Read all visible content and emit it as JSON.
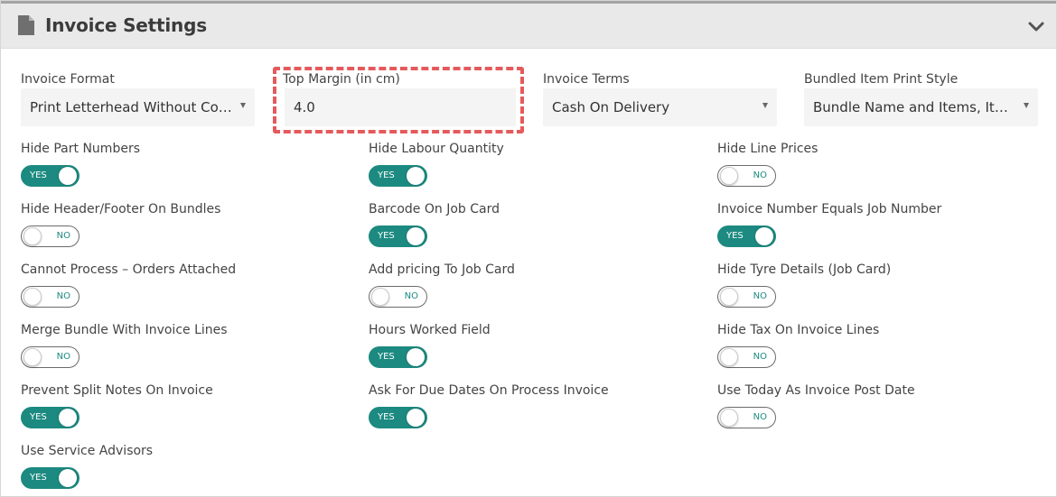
{
  "header": {
    "title": "Invoice Settings"
  },
  "fields": {
    "invoice_format": {
      "label": "Invoice Format",
      "value": "Print Letterhead Without Com..."
    },
    "top_margin": {
      "label": "Top Margin (in cm)",
      "value": "4.0"
    },
    "invoice_terms": {
      "label": "Invoice Terms",
      "value": "Cash On Delivery"
    },
    "bundled_style": {
      "label": "Bundled Item Print Style",
      "value": "Bundle Name and Items, Item ..."
    }
  },
  "toggles": [
    {
      "label": "Hide Part Numbers",
      "state": "YES"
    },
    {
      "label": "Hide Labour Quantity",
      "state": "YES"
    },
    {
      "label": "Hide Line Prices",
      "state": "NO"
    },
    {
      "label": "Hide Header/Footer On Bundles",
      "state": "NO"
    },
    {
      "label": "Barcode On Job Card",
      "state": "YES"
    },
    {
      "label": "Invoice Number Equals Job Number",
      "state": "YES"
    },
    {
      "label": "Cannot Process – Orders Attached",
      "state": "NO"
    },
    {
      "label": "Add pricing To Job Card",
      "state": "NO"
    },
    {
      "label": "Hide Tyre Details (Job Card)",
      "state": "NO"
    },
    {
      "label": "Merge Bundle With Invoice Lines",
      "state": "NO"
    },
    {
      "label": "Hours Worked Field",
      "state": "YES"
    },
    {
      "label": "Hide Tax On Invoice Lines",
      "state": "NO"
    },
    {
      "label": "Prevent Split Notes On Invoice",
      "state": "YES"
    },
    {
      "label": "Ask For Due Dates On Process Invoice",
      "state": "YES"
    },
    {
      "label": "Use Today As Invoice Post Date",
      "state": "NO"
    },
    {
      "label": "Use Service Advisors",
      "state": "YES"
    }
  ],
  "colors": {
    "accent": "#1c8a80",
    "highlight": "#e55a5c",
    "header_bg": "#e9e9e9"
  },
  "icons": {
    "header": "document-icon",
    "collapse": "chevron-down-icon"
  }
}
